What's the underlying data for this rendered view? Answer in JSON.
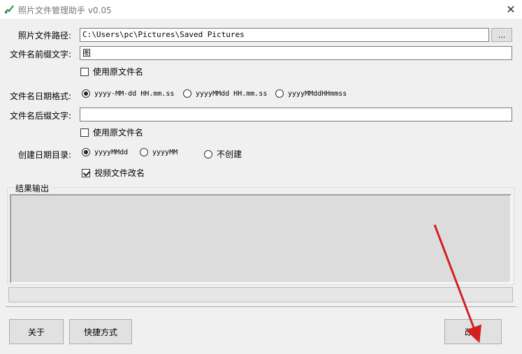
{
  "window": {
    "title": "照片文件管理助手 v0.05",
    "close_glyph": "✕",
    "accent_icon": "pencil-check-icon"
  },
  "form": {
    "path_label": "照片文件路径:",
    "path_value": "C:\\Users\\pc\\Pictures\\Saved Pictures",
    "browse_label": "...",
    "prefix_label": "文件名前缀文字:",
    "prefix_value": "图",
    "prefix_use_original": "使用原文件名",
    "date_format_label": "文件名日期格式:",
    "date_formats": [
      {
        "label": "yyyy-MM-dd HH.mm.ss",
        "selected": true
      },
      {
        "label": "yyyyMMdd HH.mm.ss",
        "selected": false
      },
      {
        "label": "yyyyMMddHHmmss",
        "selected": false
      }
    ],
    "suffix_label": "文件名后缀文字:",
    "suffix_value": "",
    "suffix_use_original": "使用原文件名",
    "dir_label": "创建日期目录:",
    "dir_options": [
      {
        "label": "yyyyMMdd",
        "selected": true
      },
      {
        "label": "yyyyMM",
        "selected": false
      },
      {
        "label": "不创建",
        "selected": false
      }
    ],
    "video_rename": "视频文件改名"
  },
  "output": {
    "label": "结果输出"
  },
  "buttons": {
    "about": "关于",
    "shortcut": "快捷方式",
    "rename": "改名"
  }
}
